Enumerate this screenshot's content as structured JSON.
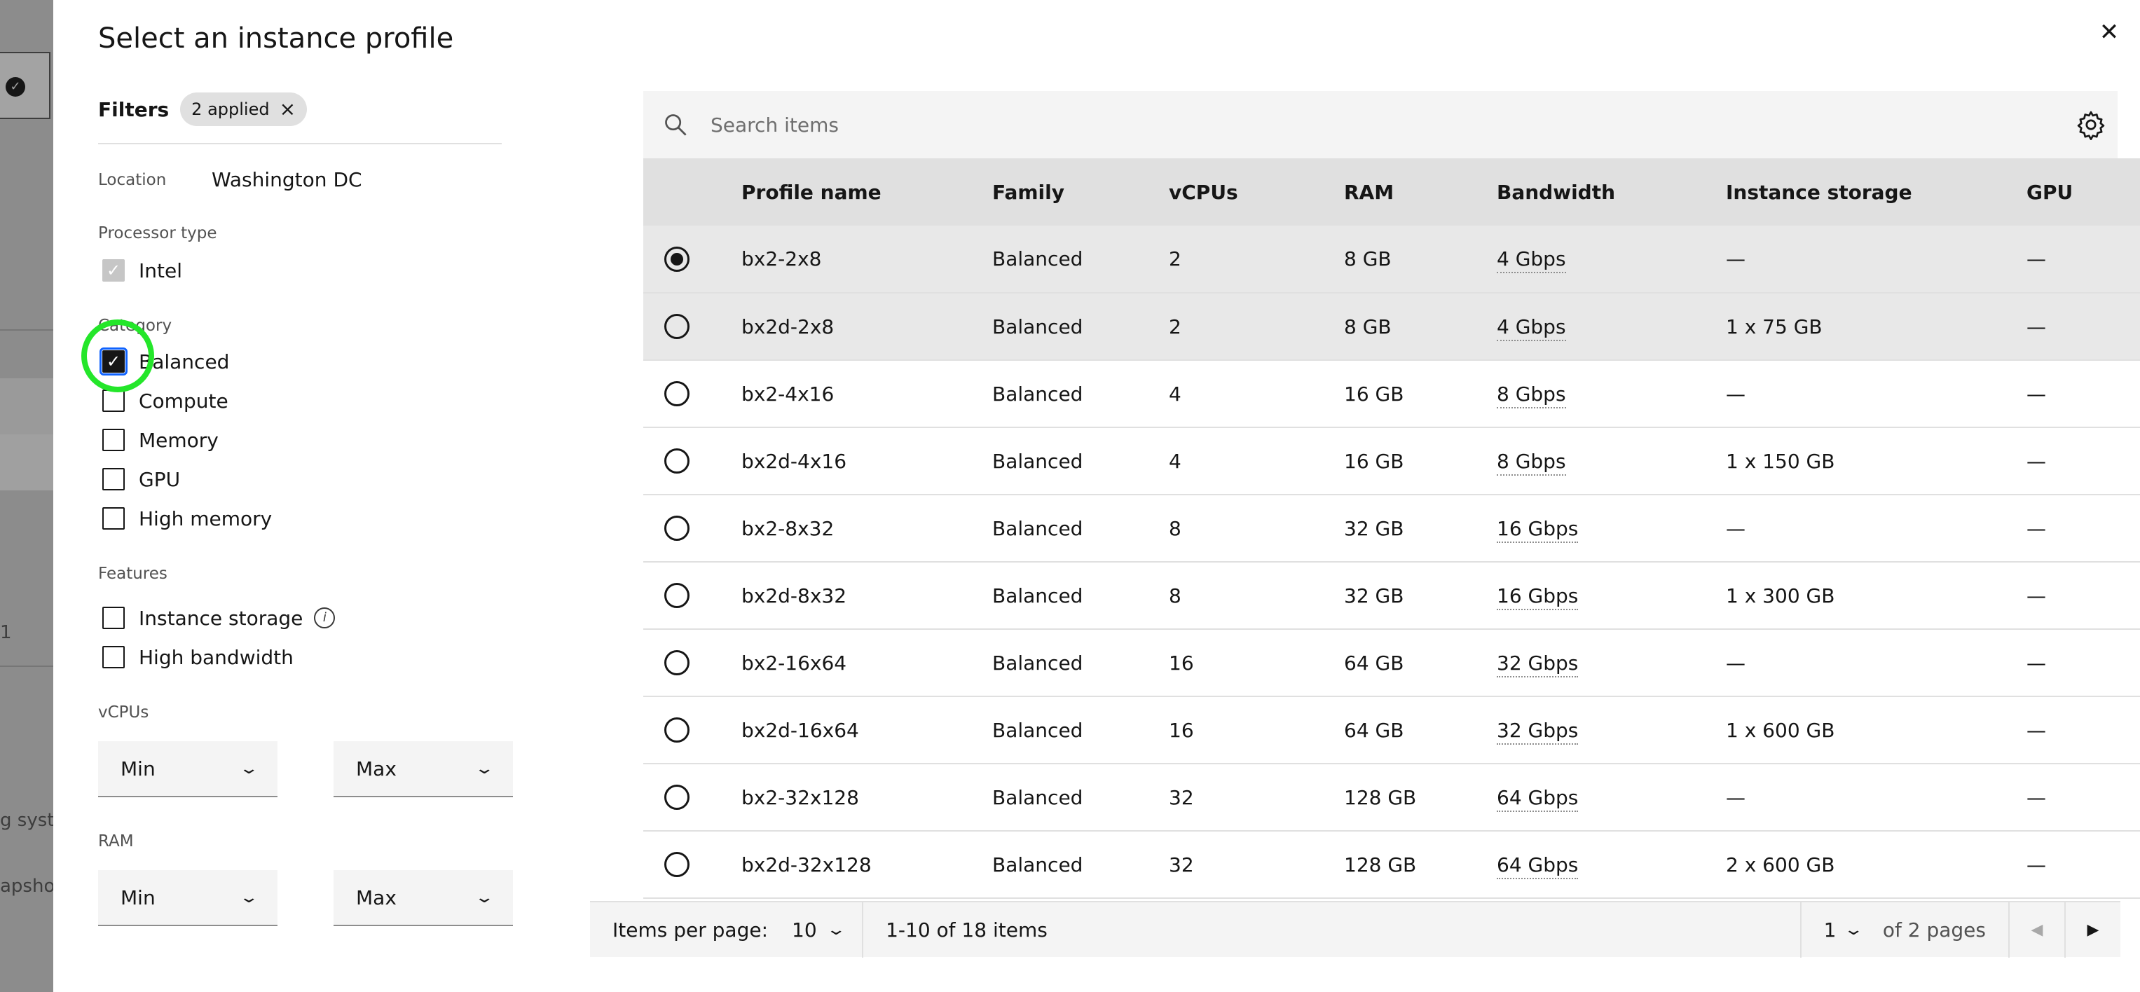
{
  "modal": {
    "title": "Select an instance profile",
    "close_icon": "close-icon"
  },
  "background": {
    "fragment_1": "1",
    "fragment_2": "g syste",
    "fragment_3": "apshot"
  },
  "filters": {
    "title": "Filters",
    "chip_label": "2 applied",
    "location_label": "Location",
    "location_value": "Washington DC",
    "processor_label": "Processor type",
    "processor_options": [
      {
        "label": "Intel",
        "checked": true,
        "disabled": true
      }
    ],
    "category_label": "Category",
    "category_options": [
      {
        "label": "Balanced",
        "checked": true
      },
      {
        "label": "Compute",
        "checked": false
      },
      {
        "label": "Memory",
        "checked": false
      },
      {
        "label": "GPU",
        "checked": false
      },
      {
        "label": "High memory",
        "checked": false
      }
    ],
    "features_label": "Features",
    "features_options": [
      {
        "label": "Instance storage",
        "checked": false,
        "info": true
      },
      {
        "label": "High bandwidth",
        "checked": false
      }
    ],
    "vcpus_label": "vCPUs",
    "vcpus_min": "Min",
    "vcpus_max": "Max",
    "ram_label": "RAM",
    "ram_min": "Min",
    "ram_max": "Max"
  },
  "table": {
    "search_placeholder": "Search items",
    "columns": [
      "Profile name",
      "Family",
      "vCPUs",
      "RAM",
      "Bandwidth",
      "Instance storage",
      "GPU"
    ],
    "rows": [
      {
        "name": "bx2-2x8",
        "family": "Balanced",
        "vcpus": "2",
        "ram": "8 GB",
        "bandwidth": "4 Gbps",
        "storage": "—",
        "gpu": "—",
        "selected": true
      },
      {
        "name": "bx2d-2x8",
        "family": "Balanced",
        "vcpus": "2",
        "ram": "8 GB",
        "bandwidth": "4 Gbps",
        "storage": "1 x 75 GB",
        "gpu": "—",
        "selected": false
      },
      {
        "name": "bx2-4x16",
        "family": "Balanced",
        "vcpus": "4",
        "ram": "16 GB",
        "bandwidth": "8 Gbps",
        "storage": "—",
        "gpu": "—",
        "selected": false
      },
      {
        "name": "bx2d-4x16",
        "family": "Balanced",
        "vcpus": "4",
        "ram": "16 GB",
        "bandwidth": "8 Gbps",
        "storage": "1 x 150 GB",
        "gpu": "—",
        "selected": false
      },
      {
        "name": "bx2-8x32",
        "family": "Balanced",
        "vcpus": "8",
        "ram": "32 GB",
        "bandwidth": "16 Gbps",
        "storage": "—",
        "gpu": "—",
        "selected": false
      },
      {
        "name": "bx2d-8x32",
        "family": "Balanced",
        "vcpus": "8",
        "ram": "32 GB",
        "bandwidth": "16 Gbps",
        "storage": "1 x 300 GB",
        "gpu": "—",
        "selected": false
      },
      {
        "name": "bx2-16x64",
        "family": "Balanced",
        "vcpus": "16",
        "ram": "64 GB",
        "bandwidth": "32 Gbps",
        "storage": "—",
        "gpu": "—",
        "selected": false
      },
      {
        "name": "bx2d-16x64",
        "family": "Balanced",
        "vcpus": "16",
        "ram": "64 GB",
        "bandwidth": "32 Gbps",
        "storage": "1 x 600 GB",
        "gpu": "—",
        "selected": false
      },
      {
        "name": "bx2-32x128",
        "family": "Balanced",
        "vcpus": "32",
        "ram": "128 GB",
        "bandwidth": "64 Gbps",
        "storage": "—",
        "gpu": "—",
        "selected": false
      },
      {
        "name": "bx2d-32x128",
        "family": "Balanced",
        "vcpus": "32",
        "ram": "128 GB",
        "bandwidth": "64 Gbps",
        "storage": "2 x 600 GB",
        "gpu": "—",
        "selected": false
      }
    ]
  },
  "pagination": {
    "items_per_page_label": "Items per page:",
    "items_per_page_value": "10",
    "range_text": "1-10 of 18 items",
    "current_page": "1",
    "of_pages": "of 2 pages"
  },
  "colors": {
    "highlight_ring": "#24e62a",
    "focus_outline": "#0f62fe",
    "header_bg": "#e0e0e0",
    "toolbar_bg": "#f4f4f4"
  }
}
